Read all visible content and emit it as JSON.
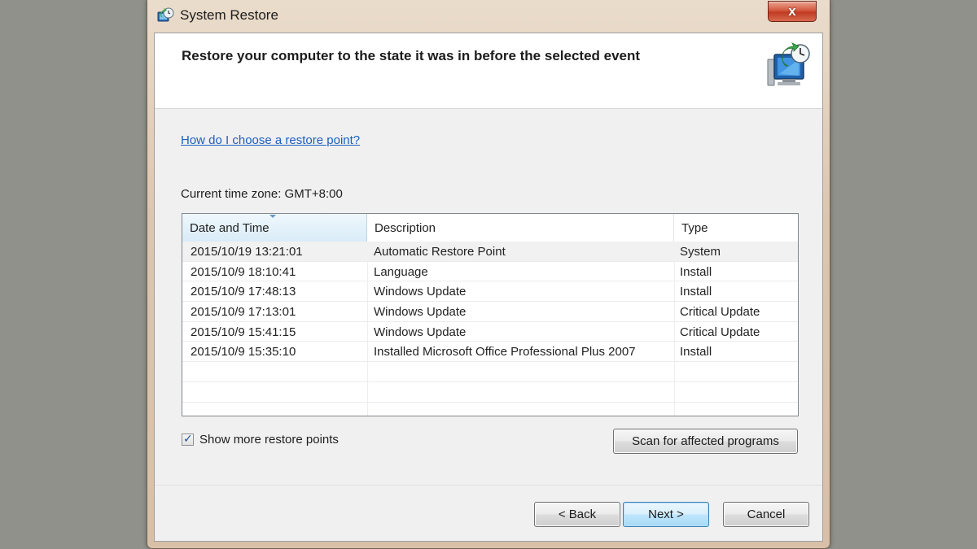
{
  "window": {
    "title": "System Restore",
    "close_label": "x"
  },
  "header": {
    "title": "Restore your computer to the state it was in before the selected event"
  },
  "help_link": "How do I choose a restore point?",
  "timezone": "Current time zone: GMT+8:00",
  "table": {
    "columns": [
      "Date and Time",
      "Description",
      "Type"
    ],
    "rows": [
      {
        "date": "2015/10/19 13:21:01",
        "description": "Automatic Restore Point",
        "type": "System"
      },
      {
        "date": "2015/10/9 18:10:41",
        "description": "Language",
        "type": "Install"
      },
      {
        "date": "2015/10/9 17:48:13",
        "description": "Windows Update",
        "type": "Install"
      },
      {
        "date": "2015/10/9 17:13:01",
        "description": "Windows Update",
        "type": "Critical Update"
      },
      {
        "date": "2015/10/9 15:41:15",
        "description": "Windows Update",
        "type": "Critical Update"
      },
      {
        "date": "2015/10/9 15:35:10",
        "description": "Installed Microsoft Office Professional Plus 2007",
        "type": "Install"
      }
    ]
  },
  "show_more": {
    "label": "Show more restore points",
    "checked": true
  },
  "buttons": {
    "scan": "Scan for affected programs",
    "back": "< Back",
    "next": "Next >",
    "cancel": "Cancel"
  },
  "colors": {
    "link": "#1d5fbf",
    "close": "#c03b22",
    "default_button": "#3c7fb1"
  }
}
